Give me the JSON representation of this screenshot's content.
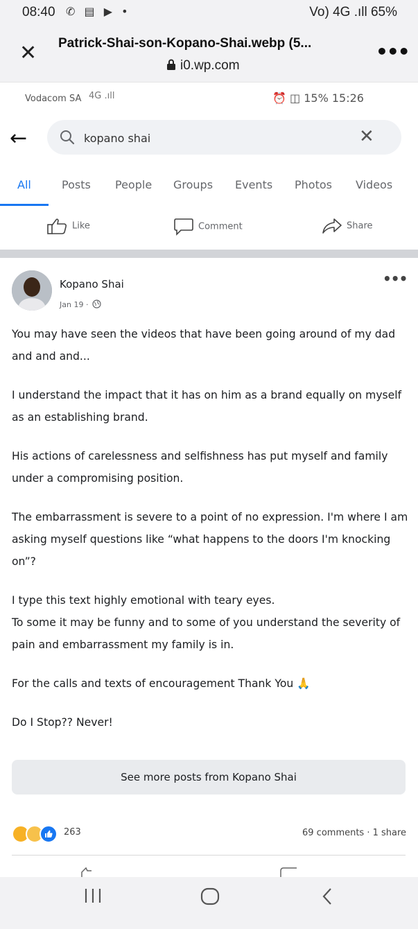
{
  "outer_status": {
    "time": "08:40",
    "left_icons": "✆ ▤ ▶ •",
    "right_text": "Vo) 4G .ıll 65%"
  },
  "viewer": {
    "title": "Patrick-Shai-son-Kopano-Shai.webp (5...",
    "url": "i0.wp.com"
  },
  "inner_status": {
    "carrier": "Vodacom SA",
    "signal": "4G .ıll",
    "right": "⏰ ◫ 15%  15:26"
  },
  "search": {
    "query": "kopano shai"
  },
  "tabs": [
    {
      "label": "All"
    },
    {
      "label": "Posts"
    },
    {
      "label": "People"
    },
    {
      "label": "Groups"
    },
    {
      "label": "Events"
    },
    {
      "label": "Photos"
    },
    {
      "label": "Videos"
    }
  ],
  "actions": {
    "like": "Like",
    "comment": "Comment",
    "share": "Share"
  },
  "post": {
    "author": "Kopano Shai",
    "date": "Jan 19 ·",
    "paragraphs": [
      "You may have seen the videos that have been going around of my dad and and and...",
      "I understand the impact that it has on him as a brand equally on myself as an establishing brand.",
      "His actions of carelessness and selfishness has put myself and family under a compromising position.",
      "The embarrassment is severe to a point of no expression. I'm where I am asking myself questions like “what happens to the doors I'm knocking on”?",
      "I type this text highly emotional with teary eyes.",
      "To some it may be funny and to some of you understand the severity of pain and embarrassment my family is in.",
      "For the calls and texts of encouragement Thank You 🙏",
      "Do I Stop?? Never!"
    ],
    "see_more": "See more posts from Kopano Shai",
    "reaction_count": "263",
    "comments_share": "69 comments · 1 share"
  },
  "colors": {
    "accent": "#1877f2",
    "like_blue": "#1877f2",
    "haha_yellow": "#f7b125",
    "sad_yellow": "#f7c14b"
  }
}
